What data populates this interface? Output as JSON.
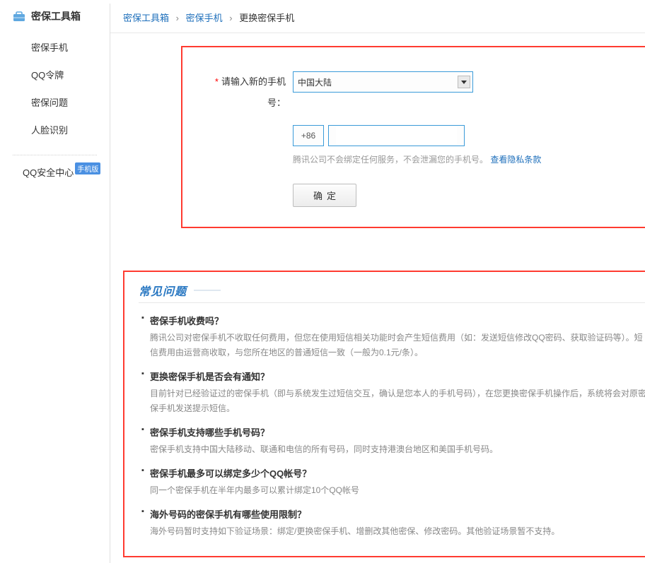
{
  "sidebar": {
    "title": "密保工具箱",
    "items": [
      {
        "label": "密保手机"
      },
      {
        "label": "QQ令牌"
      },
      {
        "label": "密保问题"
      },
      {
        "label": "人脸识别"
      }
    ],
    "security_center": "QQ安全中心",
    "mobile_badge": "手机版"
  },
  "breadcrumb": {
    "a": "密保工具箱",
    "b": "密保手机",
    "current": "更换密保手机",
    "sep": "›"
  },
  "form": {
    "label": "请输入新的手机号：",
    "country": "中国大陆",
    "prefix": "+86",
    "hint_text": "腾讯公司不会绑定任何服务，不会泄漏您的手机号。",
    "hint_link": "查看隐私条款",
    "submit": "确定"
  },
  "faq": {
    "title": "常见问题",
    "items": [
      {
        "q": "密保手机收费吗？",
        "a": "腾讯公司对密保手机不收取任何费用，但您在使用短信相关功能时会产生短信费用（如：发送短信修改QQ密码、获取验证码等）。短信费用由运营商收取，与您所在地区的普通短信一致（一般为0.1元/条）。"
      },
      {
        "q": "更换密保手机是否会有通知？",
        "a": "目前针对已经验证过的密保手机（即与系统发生过短信交互，确认是您本人的手机号码），在您更换密保手机操作后，系统将会对原密保手机发送提示短信。"
      },
      {
        "q": "密保手机支持哪些手机号码？",
        "a": "密保手机支持中国大陆移动、联通和电信的所有号码，同时支持港澳台地区和美国手机号码。"
      },
      {
        "q": "密保手机最多可以绑定多少个QQ帐号？",
        "a": "同一个密保手机在半年内最多可以累计绑定10个QQ帐号"
      },
      {
        "q": "海外号码的密保手机有哪些使用限制？",
        "a": "海外号码暂时支持如下验证场景：绑定/更换密保手机、增删改其他密保、修改密码。其他验证场景暂不支持。"
      }
    ]
  }
}
